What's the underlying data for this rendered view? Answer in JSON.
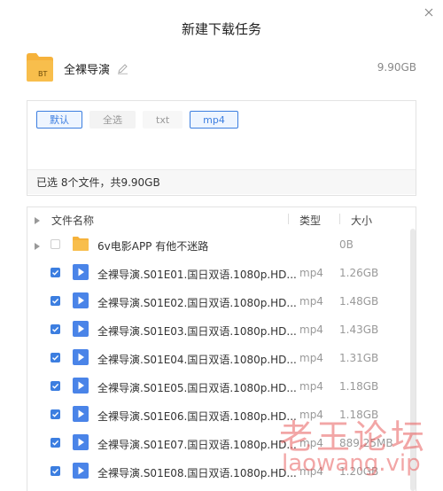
{
  "dialog": {
    "title": "新建下载任务"
  },
  "torrent": {
    "icon": "bt-folder-icon",
    "badge": "BT",
    "name": "全裸导演",
    "size": "9.90GB"
  },
  "filters": {
    "chips": [
      {
        "label": "默认",
        "state": "active"
      },
      {
        "label": "全选",
        "state": "inactive"
      },
      {
        "label": "txt",
        "state": "plain"
      },
      {
        "label": "mp4",
        "state": "active"
      }
    ],
    "summary": "已选 8个文件，共9.90GB"
  },
  "list": {
    "headers": {
      "name": "文件名称",
      "type": "类型",
      "size": "大小"
    },
    "rows": [
      {
        "type_icon": "folder-icon",
        "name": "6v电影APP 有他不迷路",
        "type": "",
        "size": "0B",
        "checked": false
      },
      {
        "type_icon": "video-icon",
        "name": "全裸导演.S01E01.国日双语.1080p.HD...",
        "type": "mp4",
        "size": "1.26GB",
        "checked": true
      },
      {
        "type_icon": "video-icon",
        "name": "全裸导演.S01E02.国日双语.1080p.HD...",
        "type": "mp4",
        "size": "1.48GB",
        "checked": true
      },
      {
        "type_icon": "video-icon",
        "name": "全裸导演.S01E03.国日双语.1080p.HD...",
        "type": "mp4",
        "size": "1.43GB",
        "checked": true
      },
      {
        "type_icon": "video-icon",
        "name": "全裸导演.S01E04.国日双语.1080p.HD...",
        "type": "mp4",
        "size": "1.31GB",
        "checked": true
      },
      {
        "type_icon": "video-icon",
        "name": "全裸导演.S01E05.国日双语.1080p.HD...",
        "type": "mp4",
        "size": "1.18GB",
        "checked": true
      },
      {
        "type_icon": "video-icon",
        "name": "全裸导演.S01E06.国日双语.1080p.HD...",
        "type": "mp4",
        "size": "1.18GB",
        "checked": true
      },
      {
        "type_icon": "video-icon",
        "name": "全裸导演.S01E07.国日双语.1080p.HD...",
        "type": "mp4",
        "size": "889.25MB",
        "checked": true
      },
      {
        "type_icon": "video-icon",
        "name": "全裸导演.S01E08.国日双语.1080p.HD...",
        "type": "mp4",
        "size": "1.20GB",
        "checked": true
      }
    ]
  },
  "watermark": {
    "cn": "老王论坛",
    "en": "laowang.vip"
  },
  "colors": {
    "accent": "#3c7ee0",
    "folder": "#f6b23b",
    "video": "#4a84e8",
    "watermark": "#e85c5c"
  }
}
